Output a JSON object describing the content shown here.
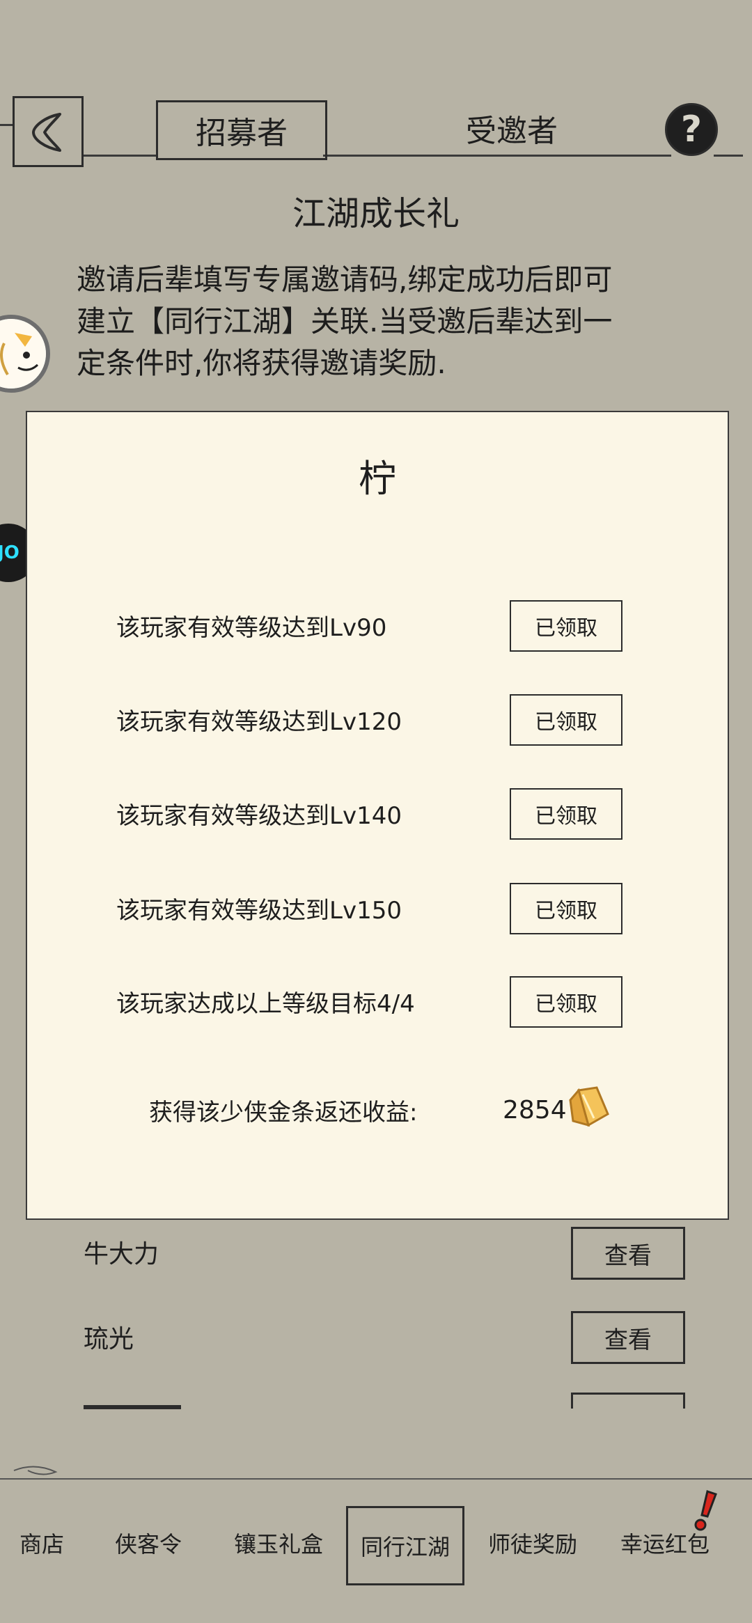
{
  "header": {
    "back_icon": "back-arrow-icon",
    "tabs": [
      {
        "label": "招募者",
        "active": true
      },
      {
        "label": "受邀者",
        "active": false
      }
    ],
    "help_label": "?"
  },
  "page": {
    "title": "江湖成长礼",
    "description_lines": [
      "邀请后辈填写专属邀请码,绑定成功后即可",
      "建立【同行江湖】关联.当受邀后辈达到一",
      "定条件时,你将获得邀请奖励."
    ]
  },
  "float_icons": {
    "a": "avatar-float-icon",
    "b_text": "JO"
  },
  "modal": {
    "player_name": "柠",
    "rows": [
      {
        "label": "该玩家有效等级达到Lv90",
        "button": "已领取"
      },
      {
        "label": "该玩家有效等级达到Lv120",
        "button": "已领取"
      },
      {
        "label": "该玩家有效等级达到Lv140",
        "button": "已领取"
      },
      {
        "label": "该玩家有效等级达到Lv150",
        "button": "已领取"
      },
      {
        "label": "该玩家达成以上等级目标4/4",
        "button": "已领取"
      }
    ],
    "refund_label": "获得该少侠金条返还收益:",
    "refund_value": "2854",
    "refund_icon": "gold-bar-icon"
  },
  "list": {
    "items": [
      {
        "name": "牛大力",
        "button": "查看"
      },
      {
        "name": "琉光",
        "button": "查看"
      }
    ]
  },
  "bottom_nav": {
    "items": [
      {
        "label": "商店",
        "active": false
      },
      {
        "label": "侠客令",
        "active": false
      },
      {
        "label": "镶玉礼盒",
        "active": false
      },
      {
        "label": "同行江湖",
        "active": true
      },
      {
        "label": "师徒奖励",
        "active": false
      },
      {
        "label": "幸运红包",
        "active": false
      }
    ]
  },
  "colors": {
    "background": "#b7b3a5",
    "modal_bg": "#fbf6e6",
    "ink": "#1e1e1e",
    "alert_red": "#d8261d",
    "gold": "#f0b040"
  }
}
